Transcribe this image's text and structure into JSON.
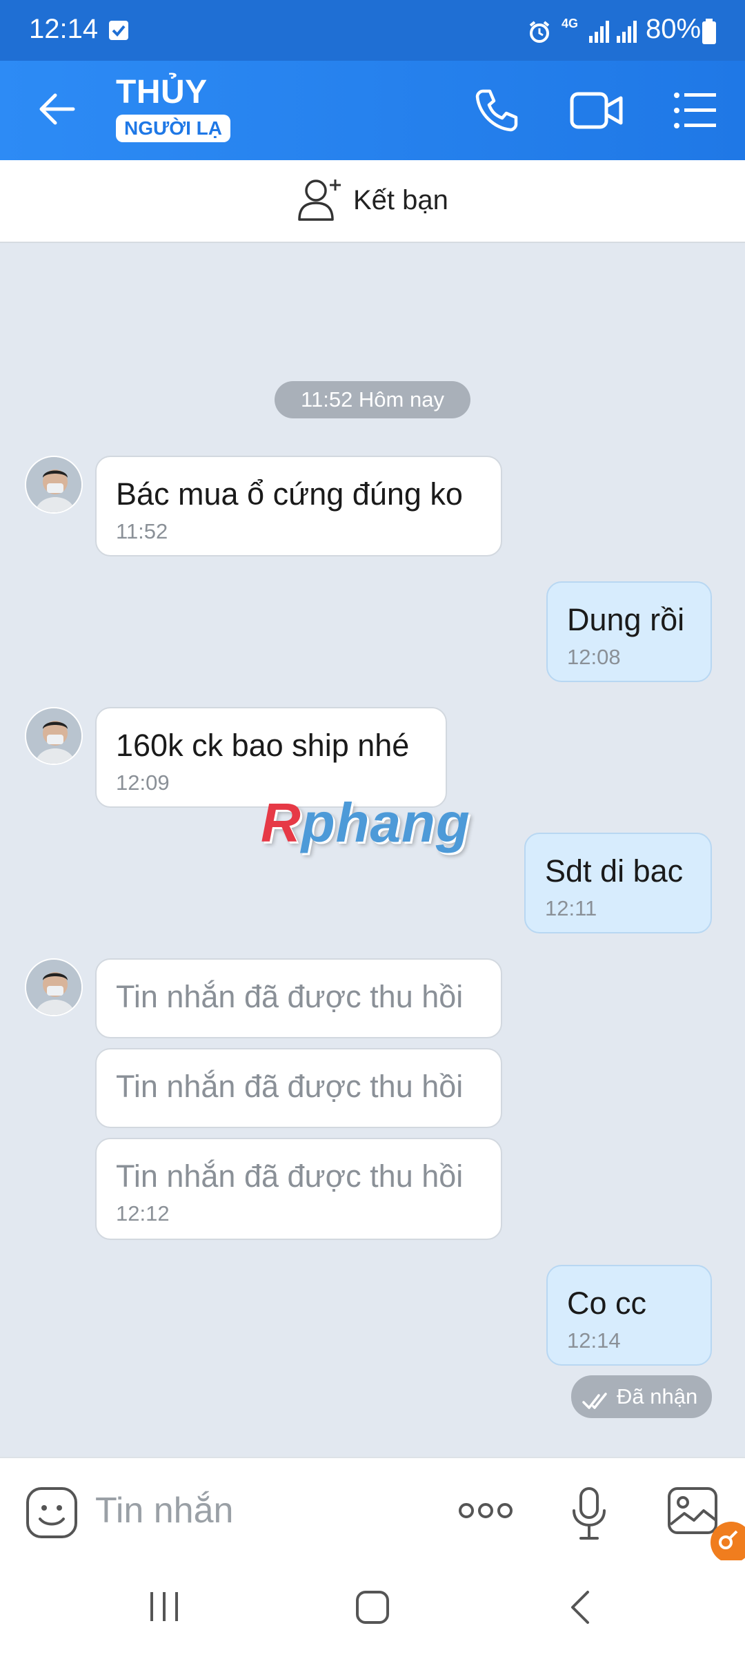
{
  "status_bar": {
    "time": "12:14",
    "network": "4G",
    "battery": "80%"
  },
  "header": {
    "contact_name": "THỦY",
    "stranger_badge": "NGƯỜI LẠ"
  },
  "friend_bar": {
    "label": "Kết bạn"
  },
  "chat": {
    "date_separator": "11:52 Hôm nay",
    "messages": [
      {
        "side": "in",
        "text": "Bác mua ổ cứng đúng ko",
        "time": "11:52"
      },
      {
        "side": "out",
        "text": "Dung rồi",
        "time": "12:08"
      },
      {
        "side": "in",
        "text": "160k ck bao ship nhé",
        "time": "12:09"
      },
      {
        "side": "out",
        "text": "Sdt di bac",
        "time": "12:11"
      },
      {
        "side": "in",
        "text": "Tin nhắn đã được thu hồi",
        "recalled": true
      },
      {
        "side": "in",
        "text": "Tin nhắn đã được thu hồi",
        "recalled": true
      },
      {
        "side": "in",
        "text": "Tin nhắn đã được thu hồi",
        "time": "12:12",
        "recalled": true
      },
      {
        "side": "out",
        "text": "Co cc",
        "time": "12:14"
      }
    ],
    "delivery_status": "Đã nhận"
  },
  "watermark": {
    "first_letter": "R",
    "rest": "phang"
  },
  "input": {
    "placeholder": "Tin nhắn"
  },
  "colors": {
    "header": "#2d8bf5",
    "outgoing_bubble": "#d7ecfd",
    "chat_bg": "#e2e8f0"
  }
}
